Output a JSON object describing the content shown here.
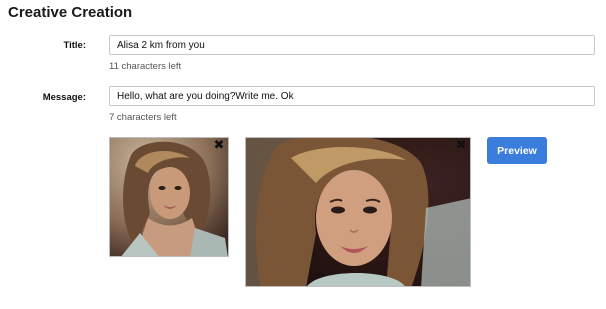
{
  "page": {
    "title": "Creative Creation"
  },
  "form": {
    "title_label": "Title:",
    "title_value": "Alisa 2 km from you",
    "title_hint": "11 characters left",
    "message_label": "Message:",
    "message_value": "Hello, what are you doing?Write me. Ok",
    "message_hint": "7 characters left"
  },
  "images": {
    "close_glyph": "✖"
  },
  "actions": {
    "preview_label": "Preview"
  },
  "colors": {
    "accent": "#3b7ddd"
  }
}
